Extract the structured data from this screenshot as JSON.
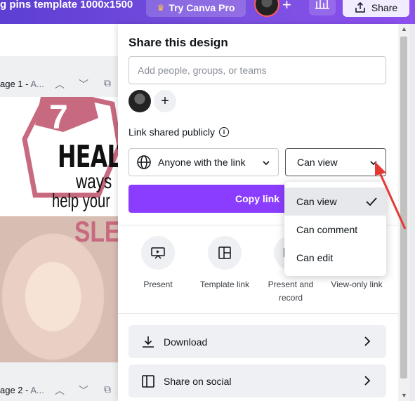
{
  "topbar": {
    "doc_title": "g pins template 1000x1500",
    "try_pro": "Try Canva Pro",
    "share": "Share"
  },
  "pages": [
    {
      "label": "age 1 -",
      "suffix": "A..."
    },
    {
      "label": "age 2 -",
      "suffix": "A..."
    }
  ],
  "design": {
    "badge_number": "7",
    "line1": "HEALT",
    "line2": "ways",
    "line3": "help your",
    "line4": "SLEE"
  },
  "panel": {
    "title": "Share this design",
    "people_placeholder": "Add people, groups, or teams",
    "link_label": "Link shared publicly",
    "access_select": "Anyone with the link",
    "permission_select": "Can view",
    "copy_link": "Copy link",
    "actions": [
      {
        "label": "Present",
        "icon": "present-icon"
      },
      {
        "label": "Template link",
        "icon": "template-icon"
      },
      {
        "label": "Present and record",
        "icon": "record-icon"
      },
      {
        "label": "View-only link",
        "icon": "link-icon"
      }
    ],
    "rows": [
      {
        "label": "Download",
        "icon": "download-icon"
      },
      {
        "label": "Share on social",
        "icon": "social-icon"
      }
    ]
  },
  "dropdown": {
    "options": [
      "Can view",
      "Can comment",
      "Can edit"
    ],
    "selected": "Can view"
  },
  "colors": {
    "brand": "#8b3dff",
    "annotation_arrow": "#e53935",
    "design_accent": "#c86a7f"
  }
}
